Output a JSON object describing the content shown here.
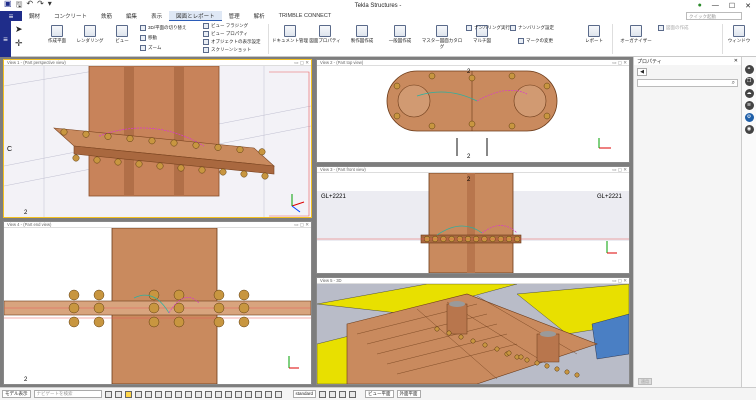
{
  "app": {
    "title": "Tekla Structures -",
    "user_icon": "user-icon"
  },
  "quick_search_placeholder": "クイック起動",
  "menu": {
    "file_icon": "file-menu-icon",
    "tabs": [
      "鋼材",
      "コンクリート",
      "鉄筋",
      "編集",
      "表示",
      "図面とレポート",
      "管理",
      "解析",
      "TRIMBLE CONNECT"
    ],
    "active": 5
  },
  "ribbon": {
    "large": [
      "作成平面",
      "レンダリング",
      "ビュー",
      "ドキュメント管理",
      "図面プロパティ",
      "製作図作成",
      "一般図作成",
      "マスター図面カタログ",
      "マルチ図",
      "レポート",
      "オーガナイザー",
      "ウィンドウ"
    ],
    "small": [
      "3D/平面の切り替え",
      "移動",
      "ズーム",
      "ビュー フラジング",
      "ビュー プロパティ",
      "オブジェクトの表示設定",
      "スクリーンショット",
      "ナンバリング実行",
      "ナンバリング設定",
      "マークの変更",
      "図面の作成"
    ]
  },
  "views": [
    {
      "title": "View 1 - (Part perspective view)"
    },
    {
      "title": "View 2 - (Part top view)"
    },
    {
      "title": "View 3 - (Part front view)"
    },
    {
      "title": "View 4 - (Part end view)"
    },
    {
      "title": "View 5 - 3D"
    }
  ],
  "labels": {
    "gl_left": "GL+2221",
    "gl_right": "GL+2221",
    "c": "C",
    "two": "2"
  },
  "property_panel": {
    "title": "プロパティ",
    "apply": "適用"
  },
  "status": {
    "select": "モデル表示",
    "search_placeholder": "ナビゲートを検索",
    "mode": "standard",
    "view_plane": "ビュー平面",
    "outer": "外面平面"
  },
  "colors": {
    "brand": "#1f2d8a",
    "steel": "#c8835a",
    "bolt": "#c89640",
    "yellow": "#e8e000"
  }
}
